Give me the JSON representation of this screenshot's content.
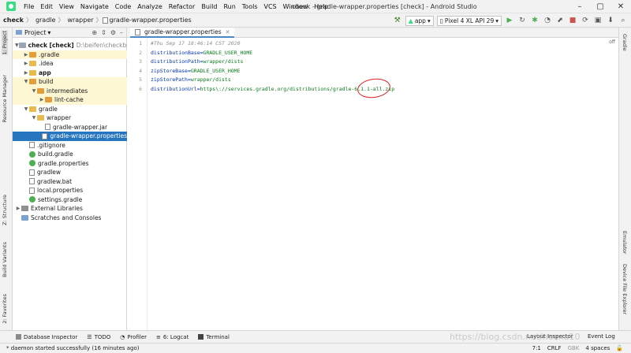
{
  "menu": [
    "File",
    "Edit",
    "View",
    "Navigate",
    "Code",
    "Analyze",
    "Refactor",
    "Build",
    "Run",
    "Tools",
    "VCS",
    "Window",
    "Help"
  ],
  "window_title": "check - gradle-wrapper.properties [check] - Android Studio",
  "breadcrumbs": [
    "check",
    "gradle",
    "wrapper",
    "gradle-wrapper.properties"
  ],
  "toolbar": {
    "config": "app",
    "device": "Pixel 4 XL API 29"
  },
  "left_tabs": [
    "1: Project",
    "Resource Manager",
    "Z: Structure",
    "Build Variants",
    "2: Favorites"
  ],
  "right_tabs": [
    "Gradle",
    "Emulator",
    "Device File Explorer"
  ],
  "project_panel": {
    "title": "Project",
    "tree": [
      {
        "label": "check [check]",
        "hint": "D:\\beifen\\checkbeif",
        "depth": 0,
        "arrow": "▼",
        "icon": "folder-icon",
        "bold": true
      },
      {
        "label": ".gradle",
        "depth": 1,
        "arrow": "▶",
        "icon": "folder-icon",
        "hl": true
      },
      {
        "label": ".idea",
        "depth": 1,
        "arrow": "▶",
        "icon": "folder-icon"
      },
      {
        "label": "app",
        "depth": 1,
        "arrow": "▶",
        "icon": "folder-icon",
        "bold": true
      },
      {
        "label": "build",
        "depth": 1,
        "arrow": "▼",
        "icon": "folder-icon",
        "hl": true
      },
      {
        "label": "intermediates",
        "depth": 2,
        "arrow": "▼",
        "icon": "folder-icon",
        "hl": true
      },
      {
        "label": "lint-cache",
        "depth": 3,
        "arrow": "▶",
        "icon": "folder-icon",
        "hl": true
      },
      {
        "label": "gradle",
        "depth": 1,
        "arrow": "▼",
        "icon": "folder-icon"
      },
      {
        "label": "wrapper",
        "depth": 2,
        "arrow": "▼",
        "icon": "folder-icon"
      },
      {
        "label": "gradle-wrapper.jar",
        "depth": 3,
        "arrow": "",
        "icon": "file-icon"
      },
      {
        "label": "gradle-wrapper.properties",
        "depth": 3,
        "arrow": "",
        "icon": "file-icon",
        "sel": true
      },
      {
        "label": ".gitignore",
        "depth": 1,
        "arrow": "",
        "icon": "file-icon"
      },
      {
        "label": "build.gradle",
        "depth": 1,
        "arrow": "",
        "icon": "gradle-icon"
      },
      {
        "label": "gradle.properties",
        "depth": 1,
        "arrow": "",
        "icon": "gradle-icon"
      },
      {
        "label": "gradlew",
        "depth": 1,
        "arrow": "",
        "icon": "file-icon"
      },
      {
        "label": "gradlew.bat",
        "depth": 1,
        "arrow": "",
        "icon": "file-icon"
      },
      {
        "label": "local.properties",
        "depth": 1,
        "arrow": "",
        "icon": "file-icon"
      },
      {
        "label": "settings.gradle",
        "depth": 1,
        "arrow": "",
        "icon": "gradle-icon"
      },
      {
        "label": "External Libraries",
        "depth": 0,
        "arrow": "▶",
        "icon": "library-icon"
      },
      {
        "label": "Scratches and Consoles",
        "depth": 0,
        "arrow": "",
        "icon": "scratch-icon"
      }
    ]
  },
  "editor": {
    "tab_label": "gradle-wrapper.properties",
    "off_label": "off",
    "lines": [
      {
        "no": "1",
        "comment": "#Thu Sep 17 18:46:14 CST 2020"
      },
      {
        "no": "2",
        "key": "distributionBase=",
        "val": "GRADLE_USER_HOME"
      },
      {
        "no": "3",
        "key": "distributionPath=",
        "val": "wrapper/dists"
      },
      {
        "no": "4",
        "key": "zipStoreBase=",
        "val": "GRADLE_USER_HOME"
      },
      {
        "no": "5",
        "key": "zipStorePath=",
        "val": "wrapper/dists"
      },
      {
        "no": "6",
        "key": "distributionUrl=",
        "val": "https\\://services.gradle.org/distributions/gradle-6.1.1-all.zip"
      }
    ]
  },
  "bottom_tabs": [
    "Database Inspector",
    "TODO",
    "Profiler",
    "6: Logcat",
    "Terminal"
  ],
  "bottom_right_tabs": [
    "Layout Inspector",
    "Event Log"
  ],
  "status": {
    "message": "* daemon started successfully (16 minutes ago)",
    "position": "7:1",
    "line_sep": "CRLF",
    "encoding": "GBK",
    "indent": "4 spaces"
  },
  "watermark": "https://blog.csdn.net/nuoxu10",
  "colors": {
    "selection": "#2675bf",
    "folder": "#e8bb4f",
    "key": "#0033b3",
    "value": "#067d17",
    "annotation": "#e02020"
  }
}
